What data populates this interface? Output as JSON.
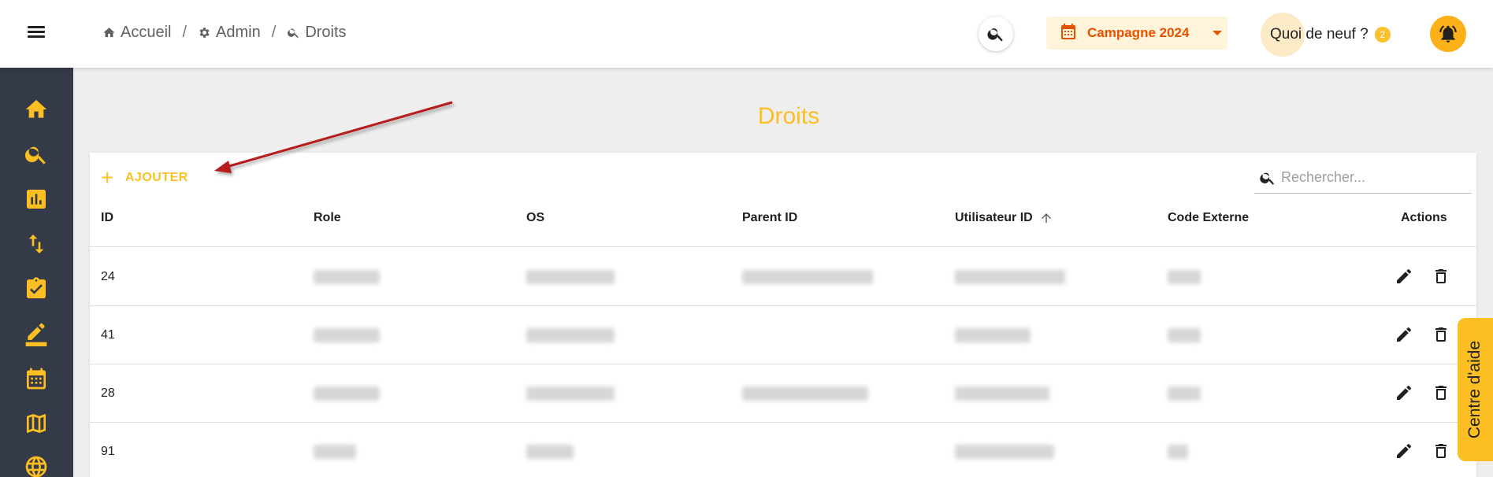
{
  "breadcrumb": [
    {
      "label": "Accueil",
      "icon": "home-icon"
    },
    {
      "label": "Admin",
      "icon": "gear-icon"
    },
    {
      "label": "Droits",
      "icon": "search-icon"
    }
  ],
  "breadcrumb_separator": "/",
  "header": {
    "campaign_label": "Campagne 2024",
    "news_label": "Quoi de neuf ?",
    "news_count": "2"
  },
  "sidebar": {
    "items": [
      {
        "icon": "home-icon"
      },
      {
        "icon": "search-icon"
      },
      {
        "icon": "bar-chart-icon"
      },
      {
        "icon": "swap-vertical-icon"
      },
      {
        "icon": "assignment-check-icon"
      },
      {
        "icon": "edit-pen-icon"
      },
      {
        "icon": "calendar-icon"
      },
      {
        "icon": "map-icon"
      },
      {
        "icon": "ball-icon"
      }
    ]
  },
  "page": {
    "title": "Droits",
    "add_label": "AJOUTER",
    "search_placeholder": "Rechercher..."
  },
  "table": {
    "columns": [
      "ID",
      "Role",
      "OS",
      "Parent ID",
      "Utilisateur ID",
      "Code Externe",
      "Actions"
    ],
    "sorted_column": "Utilisateur ID",
    "sort_direction": "ascending",
    "rows": [
      {
        "id": "24"
      },
      {
        "id": "41"
      },
      {
        "id": "28"
      },
      {
        "id": "91"
      }
    ]
  },
  "help_label": "Centre d'aide",
  "colors": {
    "accent": "#fbbf24",
    "campaign_text": "#e65100",
    "sidebar_bg": "#343a48",
    "annotation_arrow": "#b71c1c"
  }
}
